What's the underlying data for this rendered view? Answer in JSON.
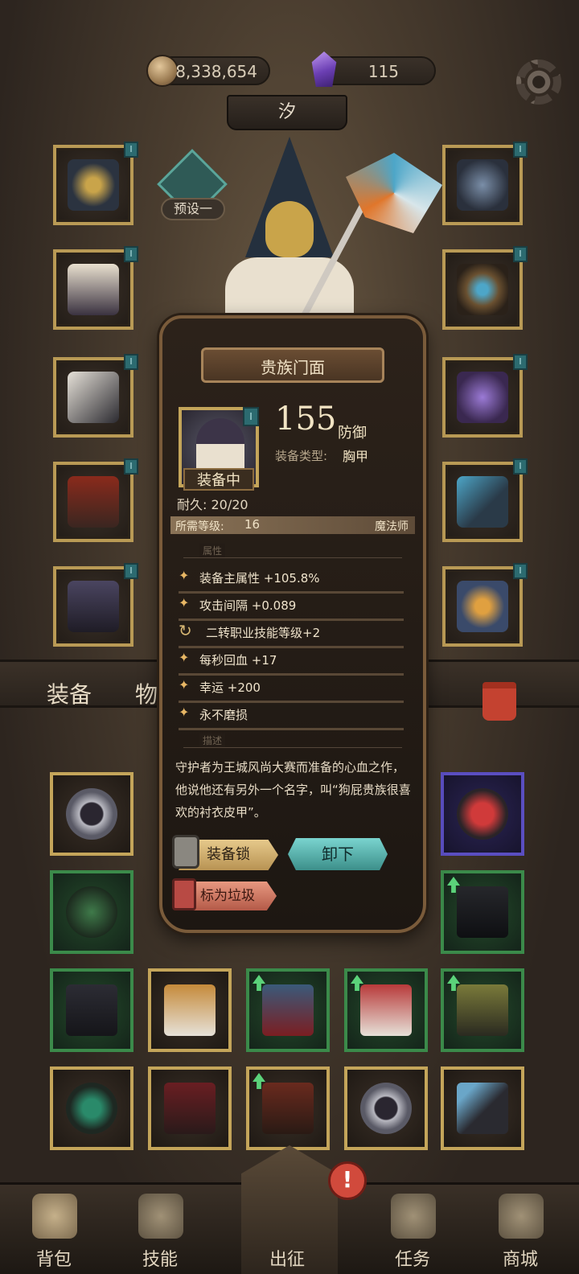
{
  "currency": {
    "coins": "8,338,654",
    "gems": "115"
  },
  "character": {
    "name": "汐",
    "preset": "预设一"
  },
  "bag_tabs": {
    "equipment": "装备",
    "items": "物"
  },
  "item_popup": {
    "name": "贵族门面",
    "equipped_label": "装备中",
    "stat_value": "155",
    "stat_unit": "防御",
    "type_label": "装备类型:",
    "type_value": "胸甲",
    "durability": "耐久: 20/20",
    "req_level_label": "所需等级:",
    "req_level": "16",
    "req_class": "魔法师",
    "attributes_header": "属性",
    "attributes": [
      "装备主属性 +105.8%",
      "攻击间隔 +0.089",
      "二转职业技能等级+2",
      "每秒回血 +17",
      "幸运 +200",
      "永不磨损"
    ],
    "description_header": "描述",
    "description": "守护者为王城风尚大赛而准备的心血之作，他说他还有另外一个名字，叫“狗屁贵族很喜欢的衬衣皮甲”。",
    "lock_button": "装备锁",
    "unequip_button": "卸下",
    "junk_button": "标为垃圾"
  },
  "bottom_nav": {
    "bag": "背包",
    "skills": "技能",
    "expedition": "出征",
    "quests": "任务",
    "shop": "商城",
    "alert": "!"
  },
  "colors": {
    "gold_frame": "#c4a55a",
    "green_frame": "#3b8a4a",
    "purple_frame": "#5a4ec1",
    "unequip_teal": "#5bb3ae",
    "junk_red": "#d07a66"
  }
}
